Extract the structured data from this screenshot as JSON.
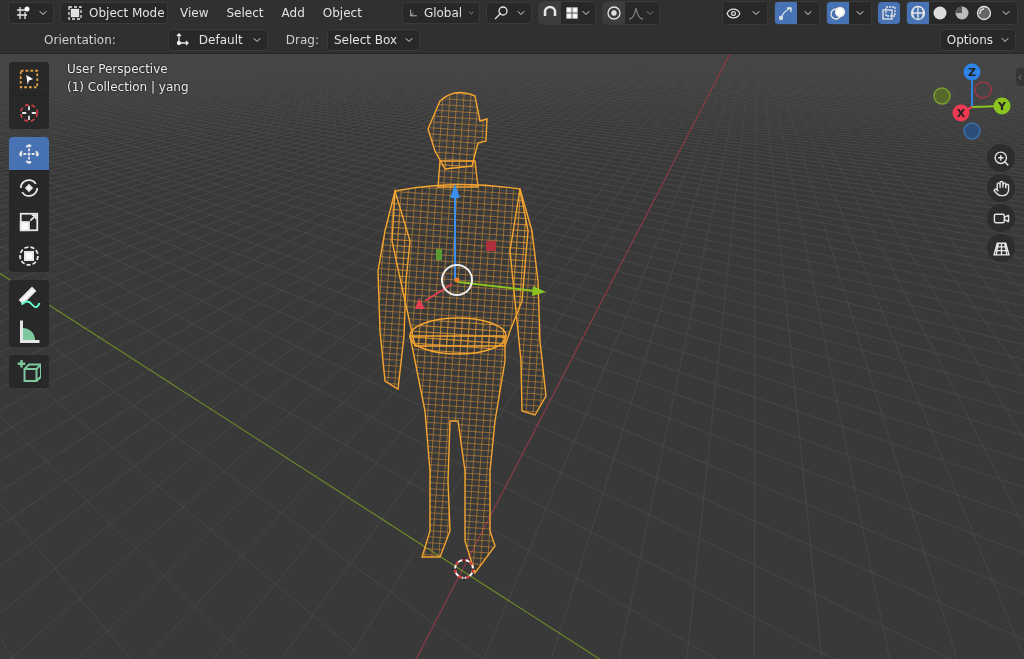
{
  "header": {
    "mode": "Object Mode",
    "menus": [
      "View",
      "Select",
      "Add",
      "Object"
    ],
    "orientation": "Global",
    "tool_toggles": [
      {
        "kind": "snap",
        "on": false
      },
      {
        "kind": "proportional",
        "on": false
      }
    ],
    "falloff": {
      "disabled": true
    },
    "view_toggles": [
      {
        "kind": "visibility",
        "on": false
      },
      {
        "kind": "gizmos",
        "on": true
      },
      {
        "kind": "overlays",
        "on": true
      },
      {
        "kind": "xray",
        "on": true
      }
    ],
    "shading": [
      {
        "kind": "wireframe",
        "selected": true
      },
      {
        "kind": "solid",
        "selected": false
      },
      {
        "kind": "material",
        "selected": false
      },
      {
        "kind": "rendered",
        "selected": false
      }
    ]
  },
  "tool_settings": {
    "orientation_label": "Orientation:",
    "orientation": "Default",
    "drag_label": "Drag:",
    "drag": "Select Box",
    "options": "Options"
  },
  "tool_groups": [
    [
      {
        "kind": "select_box",
        "selected": false
      },
      {
        "kind": "cursor",
        "selected": false
      }
    ],
    [
      {
        "kind": "move",
        "selected": true
      },
      {
        "kind": "rotate",
        "selected": false
      },
      {
        "kind": "scale",
        "selected": false
      },
      {
        "kind": "transform",
        "selected": false
      }
    ],
    [
      {
        "kind": "annotate",
        "selected": false
      },
      {
        "kind": "measure",
        "selected": false
      }
    ],
    [
      {
        "kind": "add_cube",
        "selected": false
      }
    ]
  ],
  "viewport": {
    "view_name": "User Perspective",
    "collection": "(1) Collection | yang"
  },
  "gizmo_axes": [
    {
      "kind": "z",
      "label": "Z"
    },
    {
      "kind": "y",
      "label": "Y"
    },
    {
      "kind": "x",
      "label": "X"
    }
  ],
  "nav_buttons": [
    {
      "kind": "zoom"
    },
    {
      "kind": "pan"
    },
    {
      "kind": "camera"
    },
    {
      "kind": "perspective"
    }
  ]
}
